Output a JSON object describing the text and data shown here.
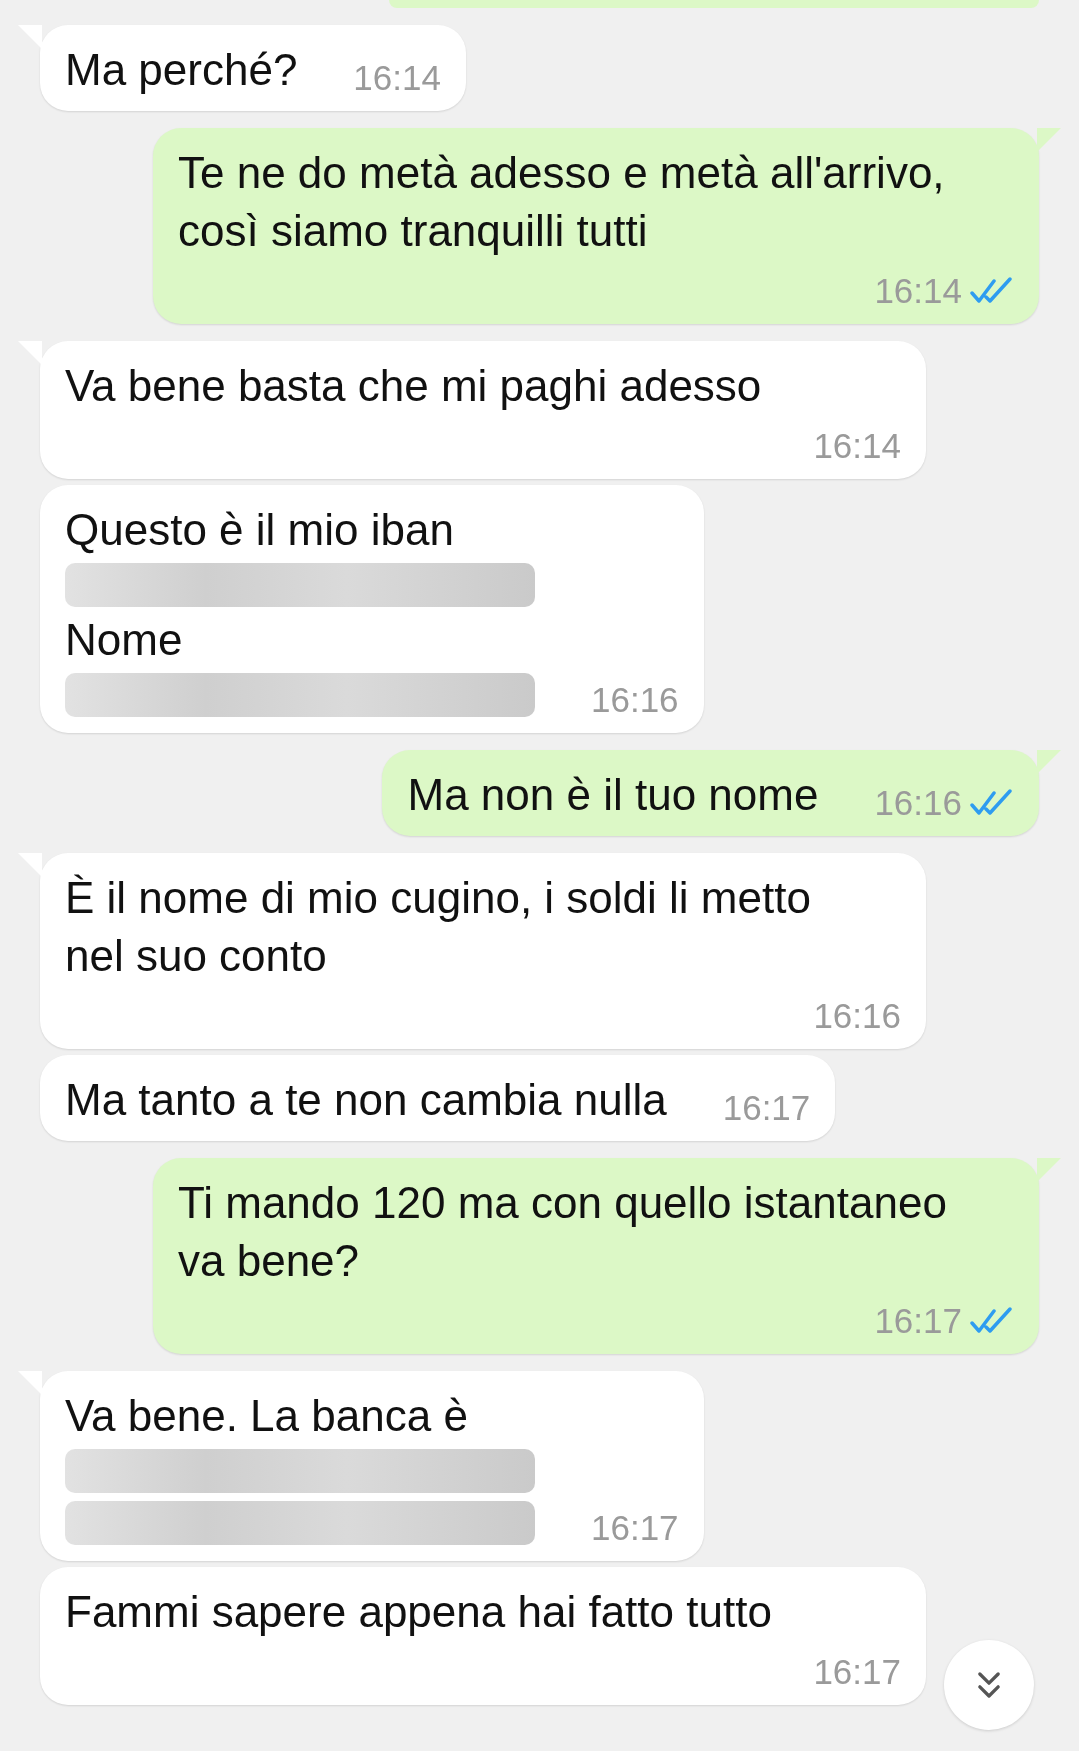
{
  "messages": [
    {
      "kind": "incoming",
      "tail": true,
      "lines": [
        {
          "kind": "text",
          "text": "Ma perché?"
        }
      ],
      "time": "16:14"
    },
    {
      "kind": "outgoing",
      "tail": true,
      "lines": [
        {
          "kind": "text",
          "text": "Te ne do metà adesso e metà all'arrivo, così siamo tranquilli tutti"
        }
      ],
      "time": "16:14",
      "read": true
    },
    {
      "kind": "incoming",
      "tail": true,
      "lines": [
        {
          "kind": "text",
          "text": "Va bene basta che mi paghi adesso"
        }
      ],
      "time": "16:14"
    },
    {
      "kind": "incoming",
      "tail": false,
      "lines": [
        {
          "kind": "text",
          "text": "Questo è il mio iban"
        },
        {
          "kind": "redacted"
        },
        {
          "kind": "text",
          "text": "Nome"
        },
        {
          "kind": "redacted"
        }
      ],
      "time": "16:16"
    },
    {
      "kind": "outgoing",
      "tail": true,
      "lines": [
        {
          "kind": "text",
          "text": "Ma non è il tuo nome"
        }
      ],
      "time": "16:16",
      "read": true
    },
    {
      "kind": "incoming",
      "tail": true,
      "lines": [
        {
          "kind": "text",
          "text": "È il nome di mio cugino, i soldi li metto nel suo conto"
        }
      ],
      "time": "16:16"
    },
    {
      "kind": "incoming",
      "tail": false,
      "lines": [
        {
          "kind": "text",
          "text": "Ma tanto a te non cambia nulla"
        }
      ],
      "time": "16:17"
    },
    {
      "kind": "outgoing",
      "tail": true,
      "lines": [
        {
          "kind": "text",
          "text": "Ti mando 120 ma con quello istantaneo va bene?"
        }
      ],
      "time": "16:17",
      "read": true
    },
    {
      "kind": "incoming",
      "tail": true,
      "lines": [
        {
          "kind": "text",
          "text": "Va bene. La banca è"
        },
        {
          "kind": "redacted"
        },
        {
          "kind": "redacted"
        }
      ],
      "time": "16:17"
    },
    {
      "kind": "incoming",
      "tail": false,
      "lines": [
        {
          "kind": "text",
          "text": "Fammi sapere appena hai fatto tutto"
        }
      ],
      "time": "16:17"
    }
  ]
}
